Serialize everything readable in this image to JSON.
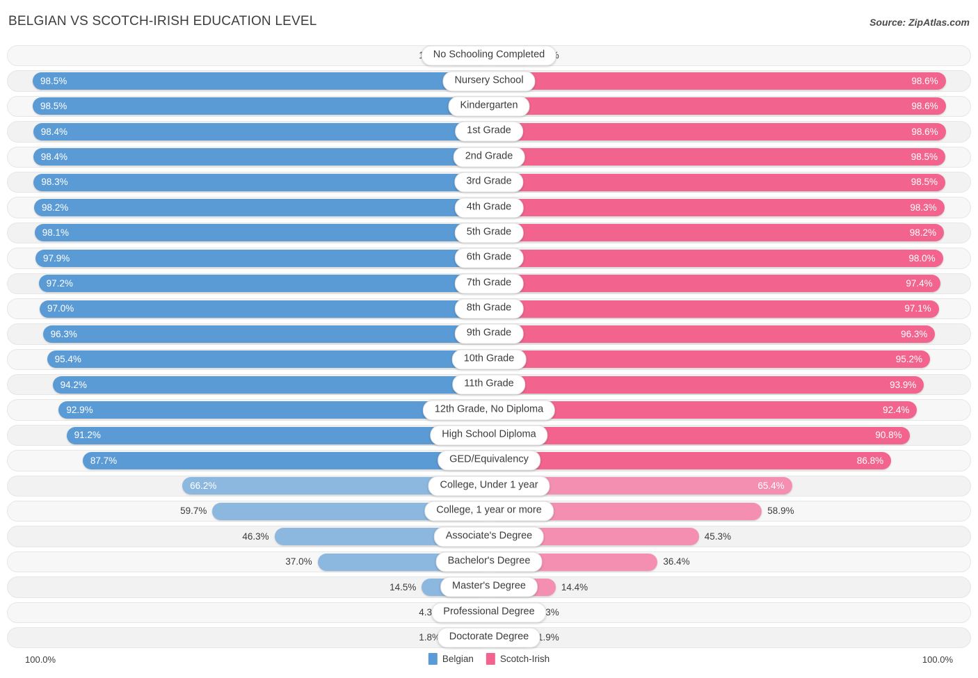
{
  "header": {
    "title": "BELGIAN VS SCOTCH-IRISH EDUCATION LEVEL",
    "source": "Source: ZipAtlas.com"
  },
  "footer": {
    "axis_left": "100.0%",
    "axis_right": "100.0%",
    "legend": [
      {
        "label": "Belgian",
        "color": "#5b9bd5"
      },
      {
        "label": "Scotch-Irish",
        "color": "#f2648e"
      }
    ]
  },
  "chart_data": {
    "type": "bar",
    "title": "BELGIAN VS SCOTCH-IRISH EDUCATION LEVEL",
    "subtitle": "Source: ZipAtlas.com",
    "orientation": "horizontal-diverging",
    "xlabel": "",
    "ylabel": "",
    "xlim": [
      0,
      100
    ],
    "grid": false,
    "legend_position": "bottom-center",
    "categories": [
      "No Schooling Completed",
      "Nursery School",
      "Kindergarten",
      "1st Grade",
      "2nd Grade",
      "3rd Grade",
      "4th Grade",
      "5th Grade",
      "6th Grade",
      "7th Grade",
      "8th Grade",
      "9th Grade",
      "10th Grade",
      "11th Grade",
      "12th Grade, No Diploma",
      "High School Diploma",
      "GED/Equivalency",
      "College, Under 1 year",
      "College, 1 year or more",
      "Associate's Degree",
      "Bachelor's Degree",
      "Master's Degree",
      "Professional Degree",
      "Doctorate Degree"
    ],
    "series": [
      {
        "name": "Belgian",
        "color": "#5b9bd5",
        "values": [
          1.6,
          98.5,
          98.5,
          98.4,
          98.4,
          98.3,
          98.2,
          98.1,
          97.9,
          97.2,
          97.0,
          96.3,
          95.4,
          94.2,
          92.9,
          91.2,
          87.7,
          66.2,
          59.7,
          46.3,
          37.0,
          14.5,
          4.3,
          1.8
        ],
        "labels": [
          "1.6%",
          "98.5%",
          "98.5%",
          "98.4%",
          "98.4%",
          "98.3%",
          "98.2%",
          "98.1%",
          "97.9%",
          "97.2%",
          "97.0%",
          "96.3%",
          "95.4%",
          "94.2%",
          "92.9%",
          "91.2%",
          "87.7%",
          "66.2%",
          "59.7%",
          "46.3%",
          "37.0%",
          "14.5%",
          "4.3%",
          "1.8%"
        ]
      },
      {
        "name": "Scotch-Irish",
        "color": "#f2648e",
        "values": [
          1.5,
          98.6,
          98.6,
          98.6,
          98.5,
          98.5,
          98.3,
          98.2,
          98.0,
          97.4,
          97.1,
          96.3,
          95.2,
          93.9,
          92.4,
          90.8,
          86.8,
          65.4,
          58.9,
          45.3,
          36.4,
          14.4,
          4.3,
          1.9
        ],
        "labels": [
          "1.5%",
          "98.6%",
          "98.6%",
          "98.6%",
          "98.5%",
          "98.5%",
          "98.3%",
          "98.2%",
          "98.0%",
          "97.4%",
          "97.1%",
          "96.3%",
          "95.2%",
          "93.9%",
          "92.4%",
          "90.8%",
          "86.8%",
          "65.4%",
          "58.9%",
          "45.3%",
          "36.4%",
          "14.4%",
          "4.3%",
          "1.9%"
        ]
      }
    ]
  }
}
